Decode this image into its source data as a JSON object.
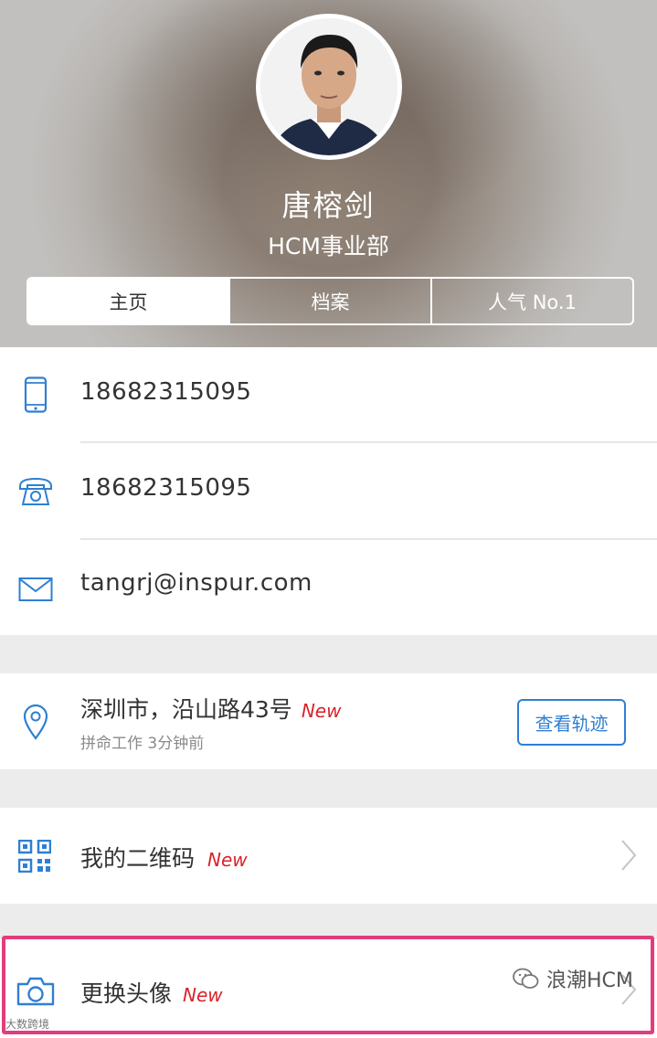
{
  "profile": {
    "name": "唐榕剑",
    "department": "HCM事业部"
  },
  "tabs": [
    {
      "label": "主页",
      "active": true
    },
    {
      "label": "档案",
      "active": false
    },
    {
      "label": "人气 No.1",
      "active": false
    }
  ],
  "contacts": {
    "mobile": {
      "icon": "mobile-phone-icon",
      "value": "18682315095"
    },
    "telephone": {
      "icon": "telephone-icon",
      "value": "18682315095"
    },
    "email": {
      "icon": "mail-icon",
      "value": "tangrj@inspur.com"
    }
  },
  "location": {
    "icon": "location-pin-icon",
    "address": "深圳市，沿山路43号",
    "badge": "New",
    "subtitle": "拼命工作 3分钟前",
    "button_label": "查看轨迹"
  },
  "qrcode": {
    "icon": "qr-code-icon",
    "label": "我的二维码",
    "badge": "New"
  },
  "avatar_change": {
    "icon": "camera-icon",
    "label": "更换头像",
    "badge": "New"
  },
  "watermark": {
    "text": "浪潮HCM",
    "small_text": "大数跨境"
  },
  "colors": {
    "accent_blue": "#2f7fd2",
    "new_badge_red": "#d8232a",
    "highlight_pink": "#e23d7d"
  }
}
